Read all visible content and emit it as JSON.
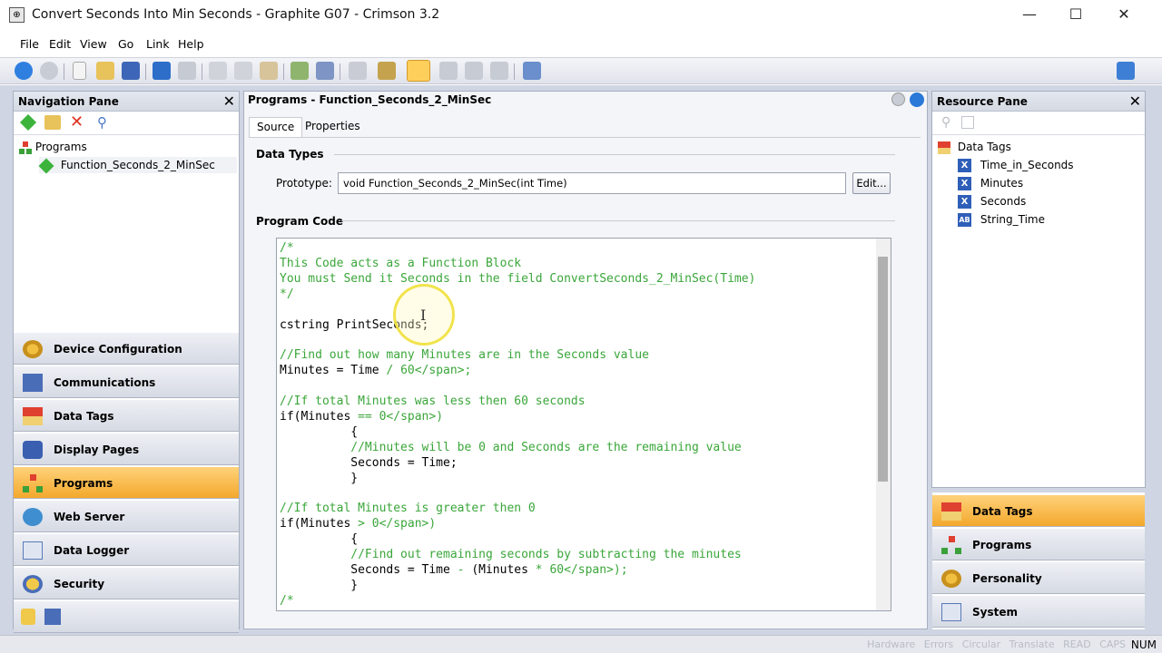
{
  "window": {
    "title": "Convert Seconds Into Min Seconds - Graphite G07 - Crimson 3.2",
    "minimize": "—",
    "maximize": "☐",
    "close": "✕"
  },
  "menu": [
    "File",
    "Edit",
    "View",
    "Go",
    "Link",
    "Help"
  ],
  "nav_pane": {
    "title": "Navigation Pane",
    "tree": {
      "root": "Programs",
      "child": "Function_Seconds_2_MinSec"
    },
    "buttons": [
      "Device Configuration",
      "Communications",
      "Data Tags",
      "Display Pages",
      "Programs",
      "Web Server",
      "Data Logger",
      "Security"
    ],
    "active_button": "Programs"
  },
  "editor": {
    "title": "Programs - Function_Seconds_2_MinSec",
    "tabs": [
      "Source",
      "Properties"
    ],
    "data_types_label": "Data Types",
    "prototype_label": "Prototype:",
    "prototype_value": "void Function_Seconds_2_MinSec(int Time)",
    "edit_button": "Edit...",
    "program_code_label": "Program Code",
    "code_lines": [
      "/*",
      "This Code acts as a Function Block",
      "You must Send it Seconds in the field ConvertSeconds_2_MinSec(Time)",
      "*/",
      "",
      "cstring PrintSeconds;",
      "",
      "//Find out how many Minutes are in the Seconds value",
      "Minutes = Time / 60;",
      "",
      "//If total Minutes was less then 60 seconds",
      "if(Minutes == 0)",
      "\t{",
      "\t//Minutes will be 0 and Seconds are the remaining value",
      "\tSeconds = Time;",
      "\t}",
      "",
      "//If total Minutes is greater then 0",
      "if(Minutes > 0)",
      "\t{",
      "\t//Find out remaining seconds by subtracting the minutes",
      "\tSeconds = Time - (Minutes * 60);",
      "\t}",
      "/*"
    ]
  },
  "resource_pane": {
    "title": "Resource Pane",
    "tree_root": "Data Tags",
    "tags": [
      {
        "name": "Time_in_Seconds",
        "icon": "X"
      },
      {
        "name": "Minutes",
        "icon": "X"
      },
      {
        "name": "Seconds",
        "icon": "X"
      },
      {
        "name": "String_Time",
        "icon": "AB"
      }
    ],
    "buttons": [
      "Data Tags",
      "Programs",
      "Personality",
      "System"
    ],
    "active_button": "Data Tags"
  },
  "status": {
    "indicators": "Hardware Errors Circular Translate READ CAPS",
    "num": "NUM"
  },
  "colors": {
    "accent_active": "#f3a82c",
    "comment_green": "#3aa63a",
    "app_background": "#cfd5e2"
  }
}
